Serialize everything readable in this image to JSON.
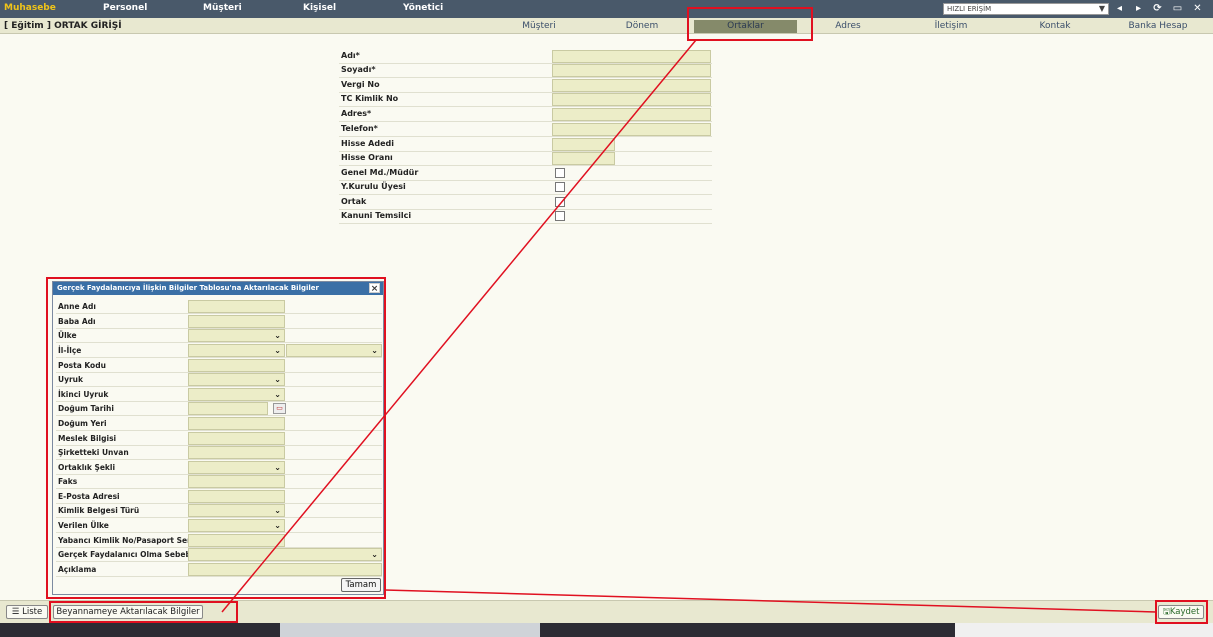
{
  "menu": {
    "items": [
      "Muhasebe",
      "Personel",
      "Müşteri",
      "Kişisel",
      "Yönetici"
    ],
    "quick_access": "HIZLI ERİŞİM"
  },
  "record": {
    "title": "[ Eğitim ] ORTAK GİRİŞİ"
  },
  "tabs": [
    "Müşteri",
    "Dönem",
    "Ortaklar",
    "Adres",
    "İletişim",
    "Kontak",
    "Banka Hesap"
  ],
  "active_tab": "Ortaklar",
  "form": {
    "labels": [
      "Adı*",
      "Soyadı*",
      "Vergi No",
      "TC Kimlik No",
      "Adres*",
      "Telefon*",
      "Hisse Adedi",
      "Hisse Oranı",
      "Genel Md./Müdür",
      "Y.Kurulu Üyesi",
      "Ortak",
      "Kanuni Temsilci"
    ]
  },
  "dialog": {
    "title": "Gerçek Faydalanıcıya İlişkin Bilgiler Tablosu'na Aktarılacak Bilgiler",
    "labels": [
      "Anne Adı",
      "Baba Adı",
      "Ülke",
      "İl-İlçe",
      "Posta Kodu",
      "Uyruk",
      "İkinci Uyruk",
      "Doğum Tarihi",
      "Doğum Yeri",
      "Meslek Bilgisi",
      "Şirketteki Unvan",
      "Ortaklık Şekli",
      "Faks",
      "E-Posta Adresi",
      "Kimlik Belgesi Türü",
      "Verilen Ülke",
      "Yabancı Kimlik No/Pasaport Seri No",
      "Gerçek Faydalanıcı Olma Sebebi",
      "Açıklama"
    ],
    "ok_button": "Tamam",
    "close": "×"
  },
  "bottom": {
    "list_button": "Liste",
    "declaration_button": "Beyannameye Aktarılacak Bilgiler",
    "save_button": "Kaydet"
  },
  "colors": {
    "accent": "#f0c419",
    "topbar": "#49596a",
    "field": "#ecedc8",
    "dialog_title": "#3a6fa6",
    "highlight": "#e01020",
    "active_tab": "#858a6a"
  }
}
